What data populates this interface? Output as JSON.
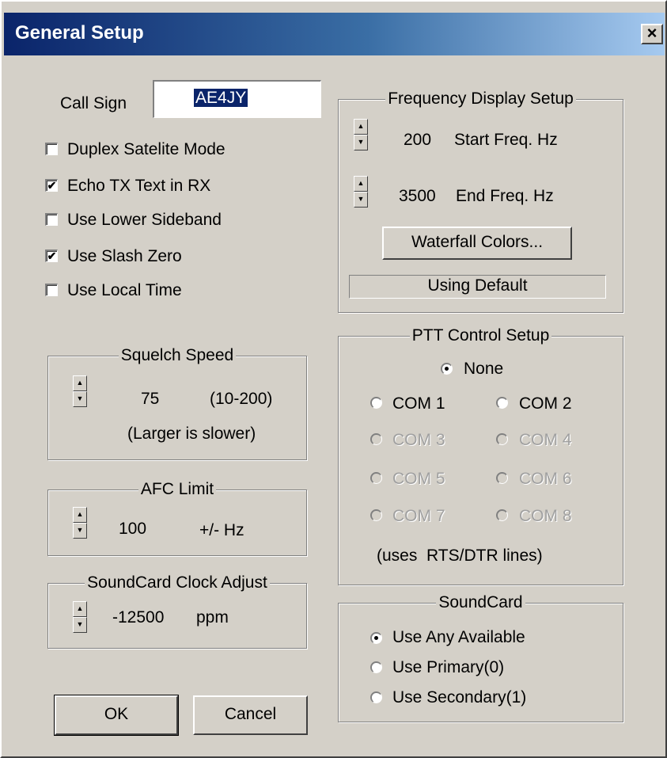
{
  "window": {
    "title": "General Setup",
    "close_glyph": "×"
  },
  "call_sign": {
    "label": "Call Sign",
    "value": "AE4JY"
  },
  "options": [
    {
      "label": "Duplex Satelite Mode",
      "checked": false
    },
    {
      "label": "Echo TX Text in RX",
      "checked": true
    },
    {
      "label": "Use Lower Sideband",
      "checked": false
    },
    {
      "label": "Use Slash Zero",
      "checked": true
    },
    {
      "label": "Use Local Time",
      "checked": false
    }
  ],
  "squelch": {
    "title": "Squelch Speed",
    "value": "75",
    "range": "(10-200)",
    "note": "(Larger is slower)"
  },
  "afc": {
    "title": "AFC Limit",
    "value": "100",
    "unit": "+/- Hz"
  },
  "clock": {
    "title": "SoundCard Clock Adjust",
    "value": "-12500",
    "unit": "ppm"
  },
  "buttons": {
    "ok": "OK",
    "cancel": "Cancel"
  },
  "freq": {
    "title": "Frequency Display Setup",
    "start_value": "200",
    "start_label": "Start Freq. Hz",
    "end_value": "3500",
    "end_label": "End Freq. Hz",
    "colors_button": "Waterfall Colors...",
    "status": "Using Default"
  },
  "ptt": {
    "title": "PTT Control Setup",
    "none": "None",
    "com1": "COM 1",
    "com2": "COM 2",
    "com3": "COM 3",
    "com4": "COM 4",
    "com5": "COM 5",
    "com6": "COM 6",
    "com7": "COM 7",
    "com8": "COM 8",
    "note": "(uses  RTS/DTR lines)"
  },
  "soundcard": {
    "title": "SoundCard",
    "any": "Use Any Available",
    "primary": "Use Primary(0)",
    "secondary": "Use Secondary(1)"
  },
  "icons": {
    "check_glyph": "✔",
    "up": "▲",
    "down": "▼"
  }
}
